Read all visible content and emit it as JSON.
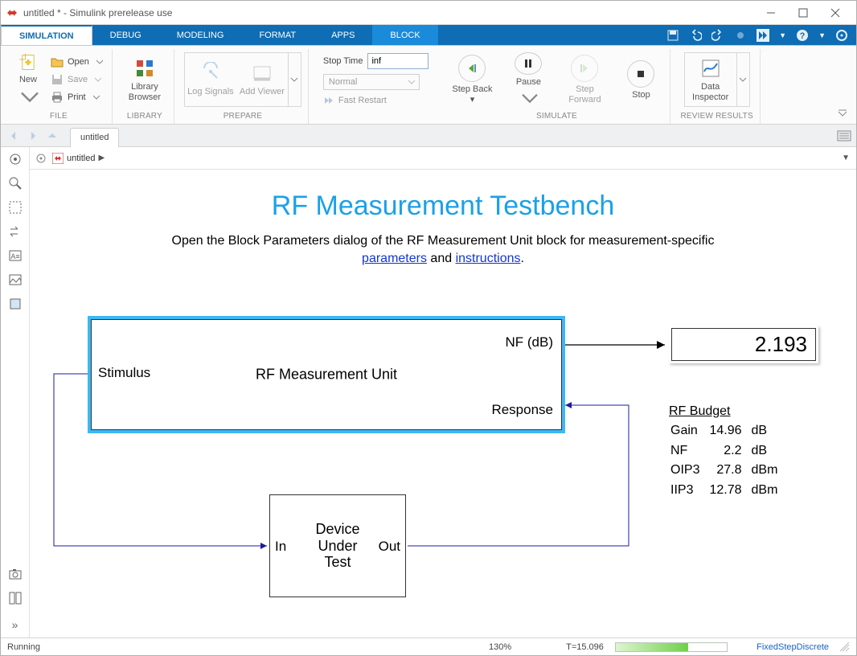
{
  "titlebar": {
    "title": "untitled * - Simulink prerelease use"
  },
  "tabs": {
    "items": [
      "SIMULATION",
      "DEBUG",
      "MODELING",
      "FORMAT",
      "APPS",
      "BLOCK"
    ],
    "active": 0,
    "highlight": 5
  },
  "ribbon": {
    "file": {
      "label": "FILE",
      "new": "New",
      "open": "Open",
      "save": "Save",
      "print": "Print"
    },
    "library": {
      "label": "LIBRARY",
      "browser": "Library Browser"
    },
    "prepare": {
      "label": "PREPARE",
      "log": "Log Signals",
      "add": "Add Viewer"
    },
    "stop": {
      "stoptime_label": "Stop Time",
      "stoptime_value": "inf",
      "mode": "Normal",
      "fast": "Fast Restart"
    },
    "simulate": {
      "label": "SIMULATE",
      "stepback": "Step Back",
      "pause": "Pause",
      "stepfwd": "Step Forward",
      "stop": "Stop"
    },
    "review": {
      "label": "REVIEW RESULTS",
      "data": "Data Inspector"
    }
  },
  "modeltab": "untitled",
  "crumb": {
    "name": "untitled"
  },
  "diagram": {
    "title": "RF Measurement Testbench",
    "sub_pre": "Open the Block Parameters dialog of the RF Measurement Unit block for measurement-specific ",
    "link1": "parameters",
    "sub_mid": " and ",
    "link2": "instructions",
    "sub_post": ".",
    "rfblock": {
      "name": "RF Measurement Unit",
      "port_stim": "Stimulus",
      "port_nf": "NF (dB)",
      "port_resp": "Response"
    },
    "dut": {
      "name_l1": "Device",
      "name_l2": "Under",
      "name_l3": "Test",
      "port_in": "In",
      "port_out": "Out"
    },
    "display": "2.193",
    "budget": {
      "title": "RF Budget",
      "rows": [
        {
          "k": "Gain",
          "v": "14.96",
          "u": "dB"
        },
        {
          "k": "NF",
          "v": "2.2",
          "u": "dB"
        },
        {
          "k": "OIP3",
          "v": "27.8",
          "u": "dBm"
        },
        {
          "k": "IIP3",
          "v": "12.78",
          "u": "dBm"
        }
      ]
    }
  },
  "status": {
    "state": "Running",
    "zoom": "130%",
    "time": "T=15.096",
    "solver": "FixedStepDiscrete"
  }
}
